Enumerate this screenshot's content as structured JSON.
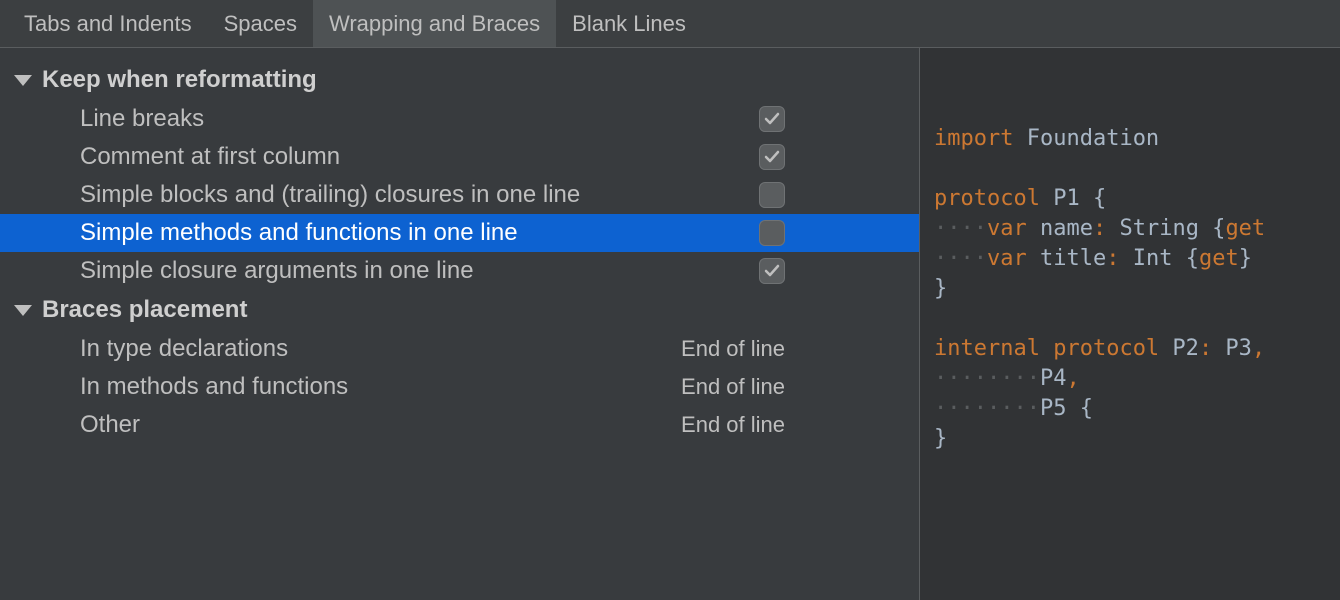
{
  "tabs": {
    "tabs_indents": "Tabs and Indents",
    "spaces": "Spaces",
    "wrapping_braces": "Wrapping and Braces",
    "blank_lines": "Blank Lines",
    "active": "wrapping_braces"
  },
  "settings": {
    "group_keep": {
      "title": "Keep when reformatting",
      "items": [
        {
          "label": "Line breaks",
          "type": "checkbox",
          "checked": true,
          "selected": false
        },
        {
          "label": "Comment at first column",
          "type": "checkbox",
          "checked": true,
          "selected": false
        },
        {
          "label": "Simple blocks and (trailing) closures in one line",
          "type": "checkbox",
          "checked": false,
          "selected": false
        },
        {
          "label": "Simple methods and functions in one line",
          "type": "checkbox",
          "checked": false,
          "selected": true
        },
        {
          "label": "Simple closure arguments in one line",
          "type": "checkbox",
          "checked": true,
          "selected": false
        }
      ]
    },
    "group_braces": {
      "title": "Braces placement",
      "items": [
        {
          "label": "In type declarations",
          "type": "select",
          "value": "End of line",
          "selected": false
        },
        {
          "label": "In methods and functions",
          "type": "select",
          "value": "End of line",
          "selected": false
        },
        {
          "label": "Other",
          "type": "select",
          "value": "End of line",
          "selected": false
        }
      ]
    }
  },
  "preview": {
    "tokens": [
      [
        {
          "t": "kw",
          "v": "import"
        },
        {
          "t": "plain",
          "v": " Foundation"
        }
      ],
      [],
      [
        {
          "t": "kw",
          "v": "protocol"
        },
        {
          "t": "plain",
          "v": " P1 {"
        }
      ],
      [
        {
          "t": "dots",
          "v": "····"
        },
        {
          "t": "kw",
          "v": "var"
        },
        {
          "t": "plain",
          "v": " name"
        },
        {
          "t": "colon",
          "v": ":"
        },
        {
          "t": "plain",
          "v": " String {"
        },
        {
          "t": "kw",
          "v": "get"
        },
        {
          "t": "plain",
          "v": " "
        }
      ],
      [
        {
          "t": "dots",
          "v": "····"
        },
        {
          "t": "kw",
          "v": "var"
        },
        {
          "t": "plain",
          "v": " title"
        },
        {
          "t": "colon",
          "v": ":"
        },
        {
          "t": "plain",
          "v": " Int {"
        },
        {
          "t": "kw",
          "v": "get"
        },
        {
          "t": "plain",
          "v": "}"
        }
      ],
      [
        {
          "t": "plain",
          "v": "}"
        }
      ],
      [],
      [
        {
          "t": "kw",
          "v": "internal"
        },
        {
          "t": "plain",
          "v": " "
        },
        {
          "t": "kw",
          "v": "protocol"
        },
        {
          "t": "plain",
          "v": " P2"
        },
        {
          "t": "colon",
          "v": ":"
        },
        {
          "t": "plain",
          "v": " P3"
        },
        {
          "t": "comma",
          "v": ","
        }
      ],
      [
        {
          "t": "dots",
          "v": "········"
        },
        {
          "t": "plain",
          "v": "P4"
        },
        {
          "t": "comma",
          "v": ","
        }
      ],
      [
        {
          "t": "dots",
          "v": "········"
        },
        {
          "t": "plain",
          "v": "P5 {"
        }
      ],
      [
        {
          "t": "plain",
          "v": "}"
        }
      ]
    ]
  }
}
